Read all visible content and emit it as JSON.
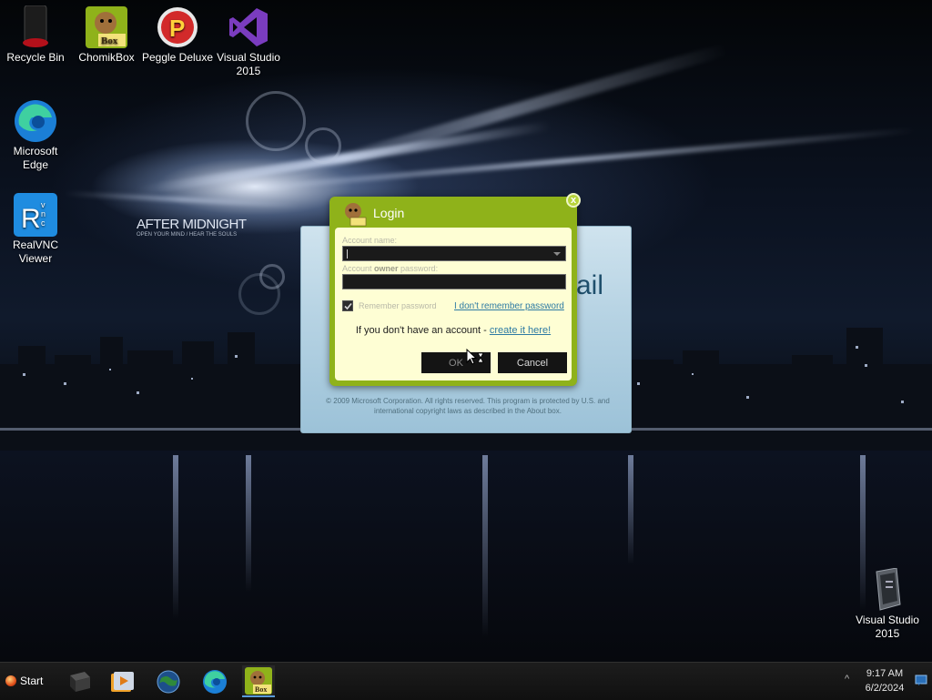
{
  "desktop": {
    "icons": [
      {
        "label": "Recycle Bin",
        "icon": "recycle-bin-icon"
      },
      {
        "label": "ChomikBox",
        "icon": "chomikbox-icon"
      },
      {
        "label": "Peggle Deluxe",
        "icon": "peggle-icon"
      },
      {
        "label": "Visual Studio 2015",
        "icon": "visual-studio-icon"
      },
      {
        "label": "Microsoft Edge",
        "icon": "edge-icon"
      },
      {
        "label": "RealVNC Viewer",
        "icon": "realvnc-icon"
      },
      {
        "label": "Visual Studio 2015",
        "icon": "visual-studio-shortcut-icon"
      }
    ],
    "wallpaper": {
      "title": "AFTER MIDNIGHT",
      "tagline": "OPEN YOUR MIND / HEAR THE SOULS"
    }
  },
  "app_window": {
    "title_fragment": "ail",
    "copyright": "© 2009 Microsoft Corporation. All rights reserved. This program is protected by U.S. and international copyright laws as described in the About box."
  },
  "login": {
    "title": "Login",
    "close_label": "x",
    "account_name_label": "Account name:",
    "account_name_value": "",
    "password_label_pre": "Account ",
    "password_label_bold": "owner",
    "password_label_post": " password:",
    "password_value": "",
    "remember_label": "Remember password",
    "remember_checked": true,
    "forgot_link": "I don't remember password",
    "no_account_text": "If you don't have an account - ",
    "create_link": "create it here!",
    "ok_label": "OK",
    "cancel_label": "Cancel"
  },
  "taskbar": {
    "start_label": "Start",
    "pinned": [
      "app-icon",
      "media-player-icon",
      "globe-icon",
      "edge-icon",
      "chomikbox-icon"
    ],
    "tray_arrow": "^",
    "time": "9:17 AM",
    "date": "6/2/2024"
  },
  "colors": {
    "dialog_green": "#8fb21a",
    "dialog_inner": "#fefed4",
    "link_blue": "#2d7aa3"
  }
}
